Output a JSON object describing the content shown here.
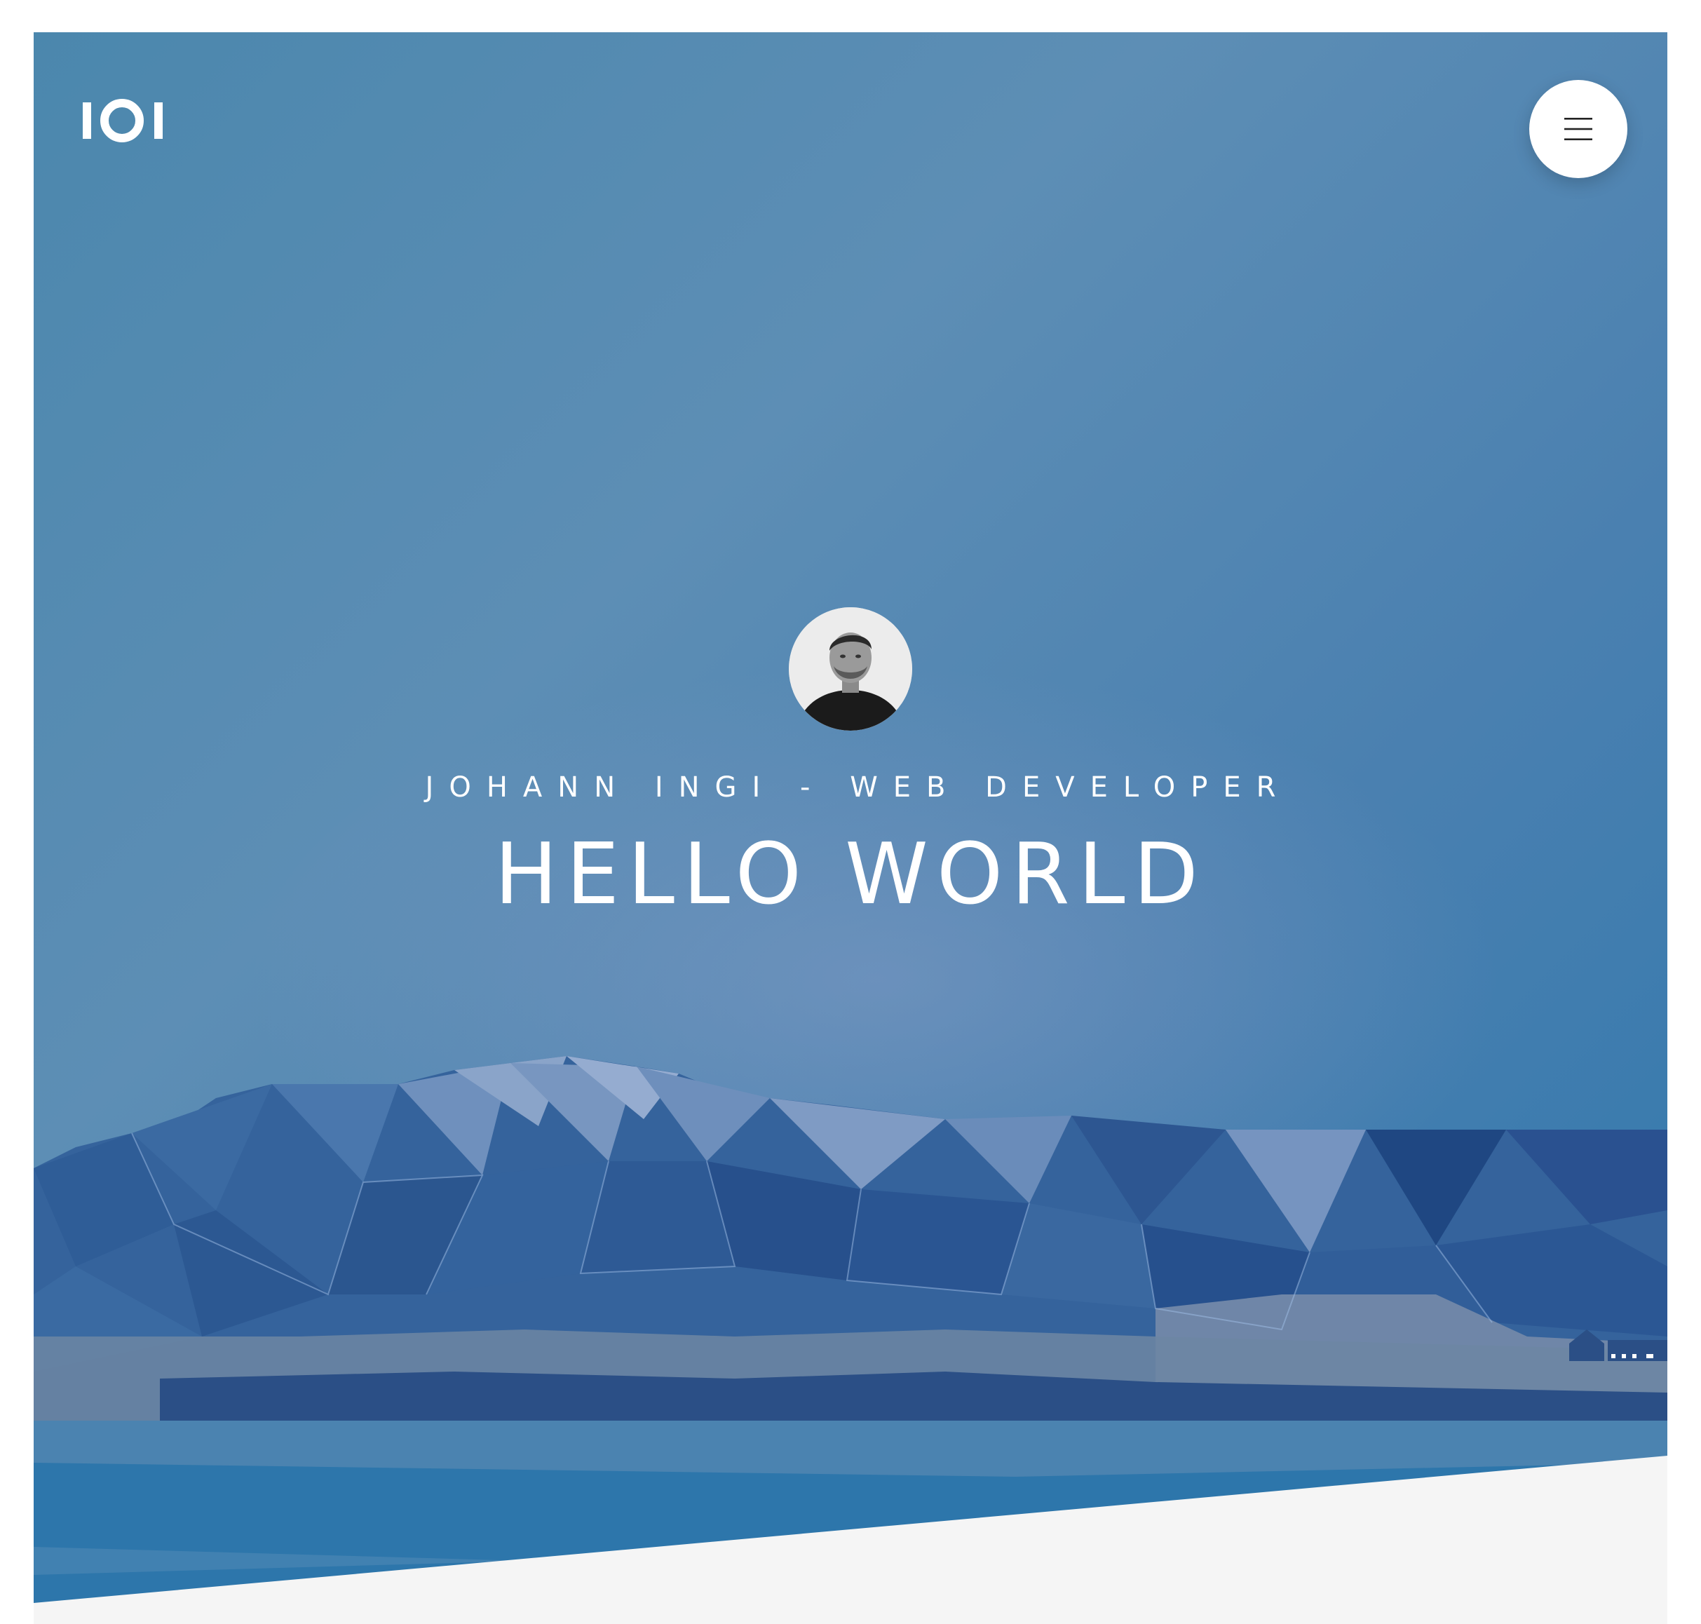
{
  "header": {
    "logo_label": "IOI",
    "menu_icon": "hamburger-icon"
  },
  "hero": {
    "subtitle": "JOHANN INGI - WEB DEVELOPER",
    "headline": "HELLO WORLD"
  },
  "colors": {
    "sky_start": "#4b87ad",
    "sky_end": "#2f78ad",
    "mountain_dark": "#27508c",
    "mountain_mid": "#35639c",
    "mountain_light": "#6e8fbc",
    "water": "#2d78ad",
    "section_bg": "#f5f5f5",
    "text": "#ffffff"
  }
}
